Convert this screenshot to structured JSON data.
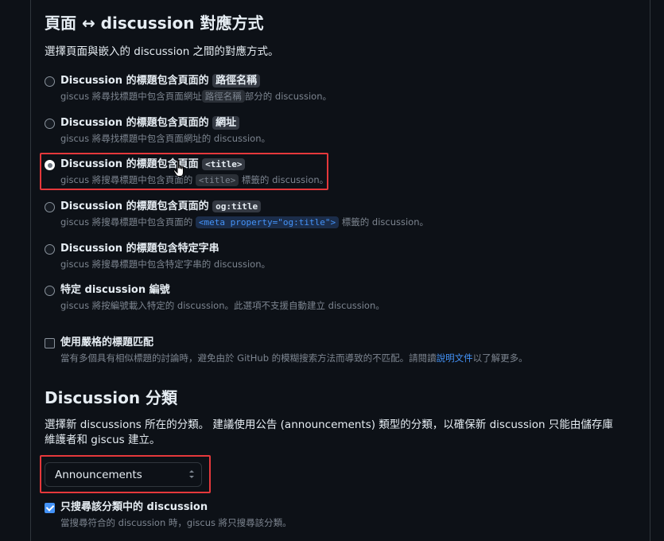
{
  "mapping": {
    "heading": "頁面 ↔ discussion 對應方式",
    "intro": "選擇頁面與嵌入的 discussion 之間的對應方式。",
    "options": [
      {
        "title_prefix": "Discussion 的標題包含頁面的",
        "title_chip": "路徑名稱",
        "desc_prefix": "giscus 將尋找標題中包含頁面網址",
        "desc_chip": "路徑名稱",
        "desc_suffix": "部分的 discussion。",
        "checked": false
      },
      {
        "title_prefix": "Discussion 的標題包含頁面的",
        "title_chip": "網址",
        "desc_text": "giscus 將尋找標題中包含頁面網址的 discussion。",
        "checked": false
      },
      {
        "title_prefix": "Discussion 的標題包含頁面",
        "title_code": "<title>",
        "desc_prefix": "giscus 將搜尋標題中包含頁面的",
        "desc_code": "<title>",
        "desc_suffix": "標籤的 discussion。",
        "checked": true
      },
      {
        "title_prefix": "Discussion 的標題包含頁面的",
        "title_code": "og:title",
        "desc_prefix": "giscus 將搜尋標題中包含頁面的",
        "desc_code": "<meta property=\"og:title\">",
        "desc_suffix": "標籤的 discussion。",
        "checked": false
      },
      {
        "title_text": "Discussion 的標題包含特定字串",
        "desc_text": "giscus 將搜尋標題中包含特定字串的 discussion。",
        "checked": false
      },
      {
        "title_text": "特定 discussion 編號",
        "desc_text": "giscus 將按編號載入特定的 discussion。此選項不支援自動建立 discussion。",
        "checked": false
      }
    ],
    "strict": {
      "label": "使用嚴格的標題匹配",
      "desc_prefix": "當有多個具有相似標題的討論時，避免由於 GitHub 的模糊搜索方法而導致的不匹配。請閱讀",
      "desc_link": "說明文件",
      "desc_suffix": "以了解更多。",
      "checked": false
    }
  },
  "category": {
    "heading": "Discussion 分類",
    "intro_line1": "選擇新 discussions 所在的分類。 建議使用公告 (announcements) 類型的分類，以確保新 discussion 只能由儲存庫",
    "intro_line2": "維護者和 giscus 建立。",
    "select_value": "Announcements",
    "only_search": {
      "label": "只搜尋該分類中的 discussion",
      "desc": "當搜尋符合的 discussion 時，giscus 將只搜尋該分類。",
      "checked": true
    }
  },
  "colors": {
    "background": "#0d1117",
    "highlight": "#e5383b",
    "accent": "#4493f8",
    "muted": "#7d8590"
  }
}
